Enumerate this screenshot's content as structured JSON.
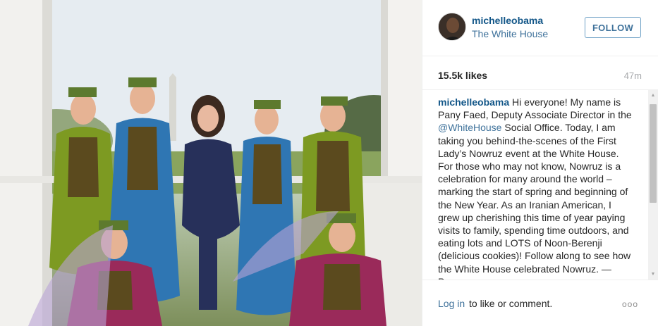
{
  "header": {
    "username": "michelleobama",
    "location": "The White House",
    "follow_label": "FOLLOW"
  },
  "stats": {
    "likes": "15.5k likes",
    "time": "47m"
  },
  "caption": {
    "username": "michelleobama",
    "text_before_mention": "Hi everyone! My name is Pany Faed, Deputy Associate Director in the",
    "mention": "@WhiteHouse",
    "text_after_mention": "Social Office. Today, I am taking you behind-the-scenes of the First Lady’s Nowruz event at the White House. For those who may not know, Nowruz is a celebration for many around the world – marking the start of spring and beginning of the New Year. As an Iranian American, I grew up cherishing this time of year paying visits to family, spending time outdoors, and eating lots and LOTS of Noon-Berenji (delicious cookies)! Follow along to see how the White House celebrated Nowruz. — Pany"
  },
  "footer": {
    "login_label": "Log in",
    "login_rest": "to like or comment.",
    "more_label": "ooo"
  },
  "icons": {
    "scroll_up": "up-arrow",
    "scroll_down": "down-arrow"
  },
  "colors": {
    "username_blue": "#125688",
    "link_blue": "#3f729b",
    "follow_border": "#6fa1c6",
    "muted_gray": "#a5a7aa",
    "divider": "#efefef"
  }
}
